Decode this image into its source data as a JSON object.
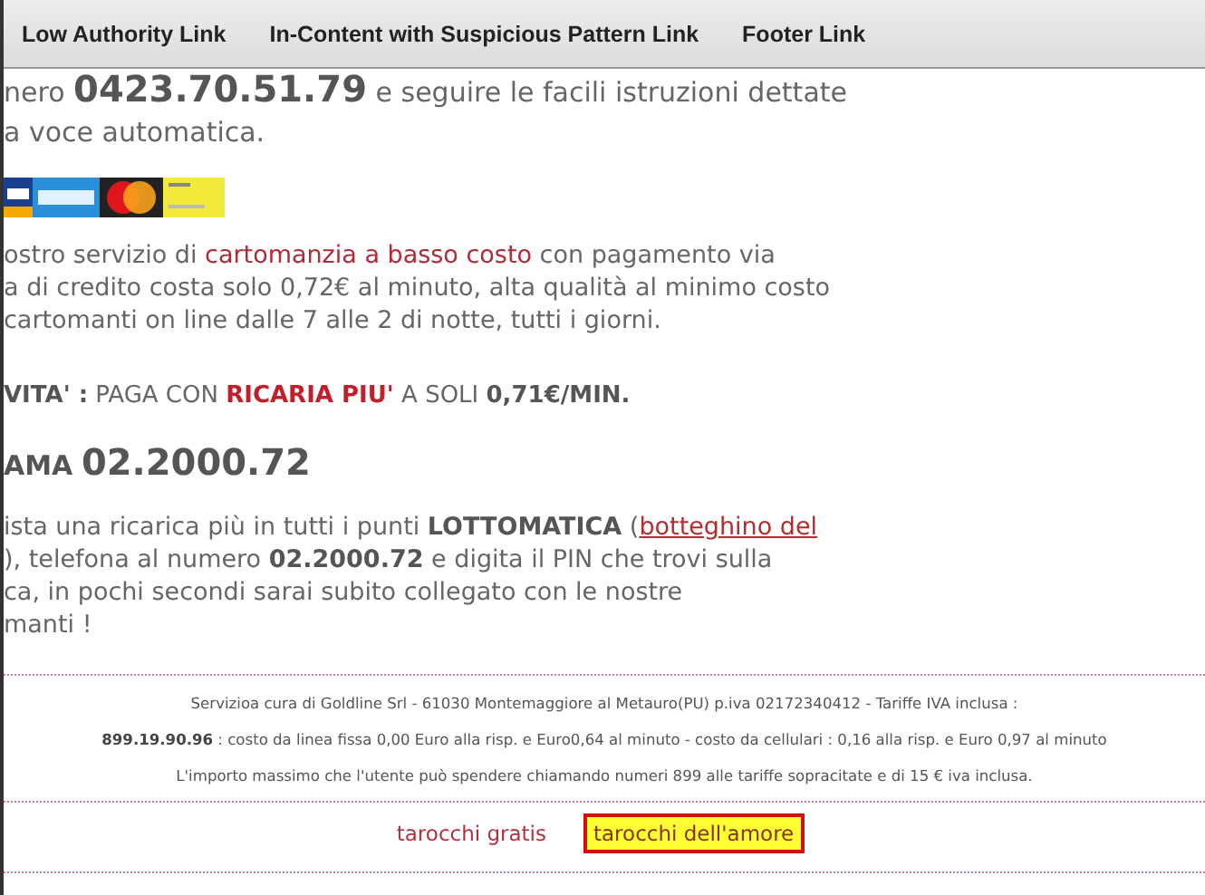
{
  "toolbar": {
    "links": [
      "Low Authority Link",
      "In-Content with Suspicious Pattern Link",
      "Footer Link"
    ]
  },
  "intro_lines": [
    [
      {
        "text": "nero ",
        "kind": "text"
      },
      {
        "text": "0423.70.51.79",
        "kind": "number"
      },
      {
        "text": " e seguire le facili istruzioni dettate",
        "kind": "text"
      }
    ],
    [
      {
        "text": "a voce automatica.",
        "kind": "text"
      }
    ]
  ],
  "payment_logos": [
    {
      "kind": "visa"
    },
    {
      "kind": "amex"
    },
    {
      "kind": "mastercard"
    },
    {
      "kind": "postepay"
    }
  ],
  "paragraph_1": [
    [
      {
        "text": "ostro servizio di ",
        "kind": "text"
      },
      {
        "text": "cartomanzia a basso costo",
        "kind": "keyword"
      },
      {
        "text": " con pagamento via",
        "kind": "text"
      }
    ],
    [
      {
        "text": "a di credito costa solo 0,72€ al minuto, alta qualità al minimo costo",
        "kind": "text"
      }
    ],
    [
      {
        "text": "cartomanti on line dalle 7 alle 2 di notte, tutti i giorni.",
        "kind": "text"
      }
    ]
  ],
  "promo_line": [
    {
      "text": "**VITA' :** PAGA CON ",
      "kind": "text"
    },
    {
      "text": "**RICARIA PIU'**",
      "kind": "keyword"
    },
    {
      "text": "  A SOLI **0,71€/MIN.**",
      "kind": "text"
    }
  ],
  "call_heading": [
    {
      "text": "**AMA** ",
      "kind": "text"
    },
    {
      "text": "02.2000.72",
      "kind": "number"
    }
  ],
  "paragraph_2": [
    [
      {
        "text": "ista una ricarica più in tutti i punti **LOTTOMATICA** (",
        "kind": "text"
      },
      {
        "text": "botteghino del",
        "kind": "link"
      }
    ],
    [
      {
        "text": "), telefona al numero **02.2000.72** e digita il PIN che trovi sulla",
        "kind": "text"
      }
    ],
    [
      {
        "text": "ca, in pochi secondi sarai subito collegato con le nostre",
        "kind": "text"
      }
    ],
    [
      {
        "text": "manti !",
        "kind": "text"
      }
    ]
  ],
  "footer_lines": [
    "Servizioa cura di Goldline Srl - 61030 Montemaggiore al Metauro(PU) p.iva 02172340412 - Tariffe IVA inclusa :",
    "**899.19.90.96** : costo da linea fissa  0,00 Euro alla risp. e Euro0,64 al minuto - costo da cellulari : 0,16 alla risp. e Euro 0,97 al minuto",
    "L'importo massimo che l'utente può spendere chiamando numeri 899 alle tariffe sopracitate e di 15 € iva inclusa."
  ],
  "footer_links": [
    {
      "label": "tarocchi gratis",
      "highlighted": false
    },
    {
      "label": "tarocchi dell'amore",
      "highlighted": true
    }
  ]
}
